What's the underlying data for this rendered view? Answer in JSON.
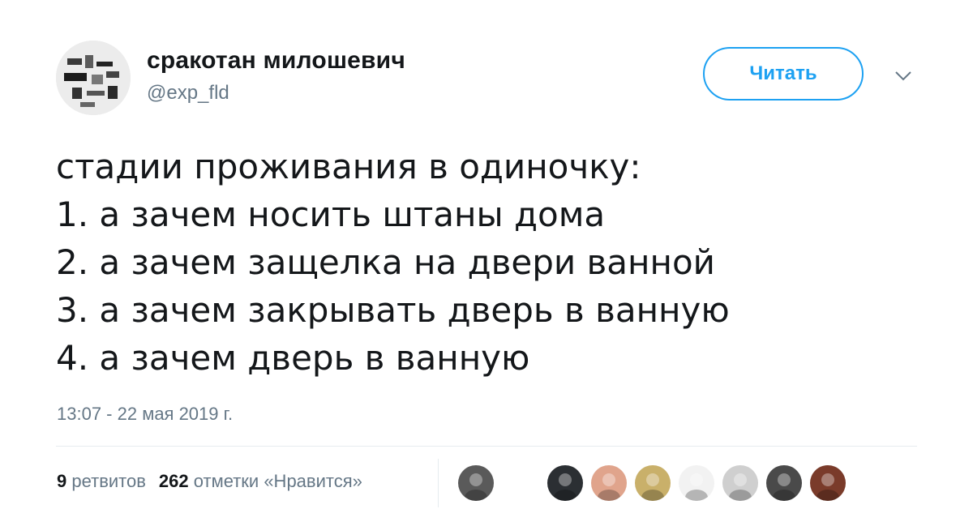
{
  "user": {
    "display_name": "сракотан милошевич",
    "handle": "@exp_fld",
    "avatar_icon": "abstract-avatar"
  },
  "follow_button": {
    "label": "Читать"
  },
  "menu": {
    "icon": "chevron-down-icon"
  },
  "tweet": {
    "lines": [
      "стадии проживания в одиночку:",
      "1. а зачем носить штаны дома",
      "2. а зачем защелка на двери ванной",
      "3. а зачем закрывать дверь в ванную",
      "4. а зачем дверь в ванную"
    ],
    "timestamp": "13:07 - 22 мая 2019 г."
  },
  "stats": {
    "retweets_count": "9",
    "retweets_label": "ретвитов",
    "likes_count": "262",
    "likes_label": "отметки «Нравится»"
  },
  "likers": [
    {
      "name": "liker-avatar-1",
      "color": "#5a5a5a"
    },
    {
      "name": "liker-avatar-2",
      "color": "#2b2f33"
    },
    {
      "name": "liker-avatar-3",
      "color": "#e0a48c"
    },
    {
      "name": "liker-avatar-4",
      "color": "#c9b06a"
    },
    {
      "name": "liker-avatar-5",
      "color": "#f2f2f2"
    },
    {
      "name": "liker-avatar-6",
      "color": "#cfcfcf"
    },
    {
      "name": "liker-avatar-7",
      "color": "#4a4a4a"
    },
    {
      "name": "liker-avatar-8",
      "color": "#7a3b2a"
    }
  ],
  "colors": {
    "accent": "#1da1f2",
    "text": "#14171a",
    "secondary": "#657786",
    "divider": "#e6ecf0"
  }
}
